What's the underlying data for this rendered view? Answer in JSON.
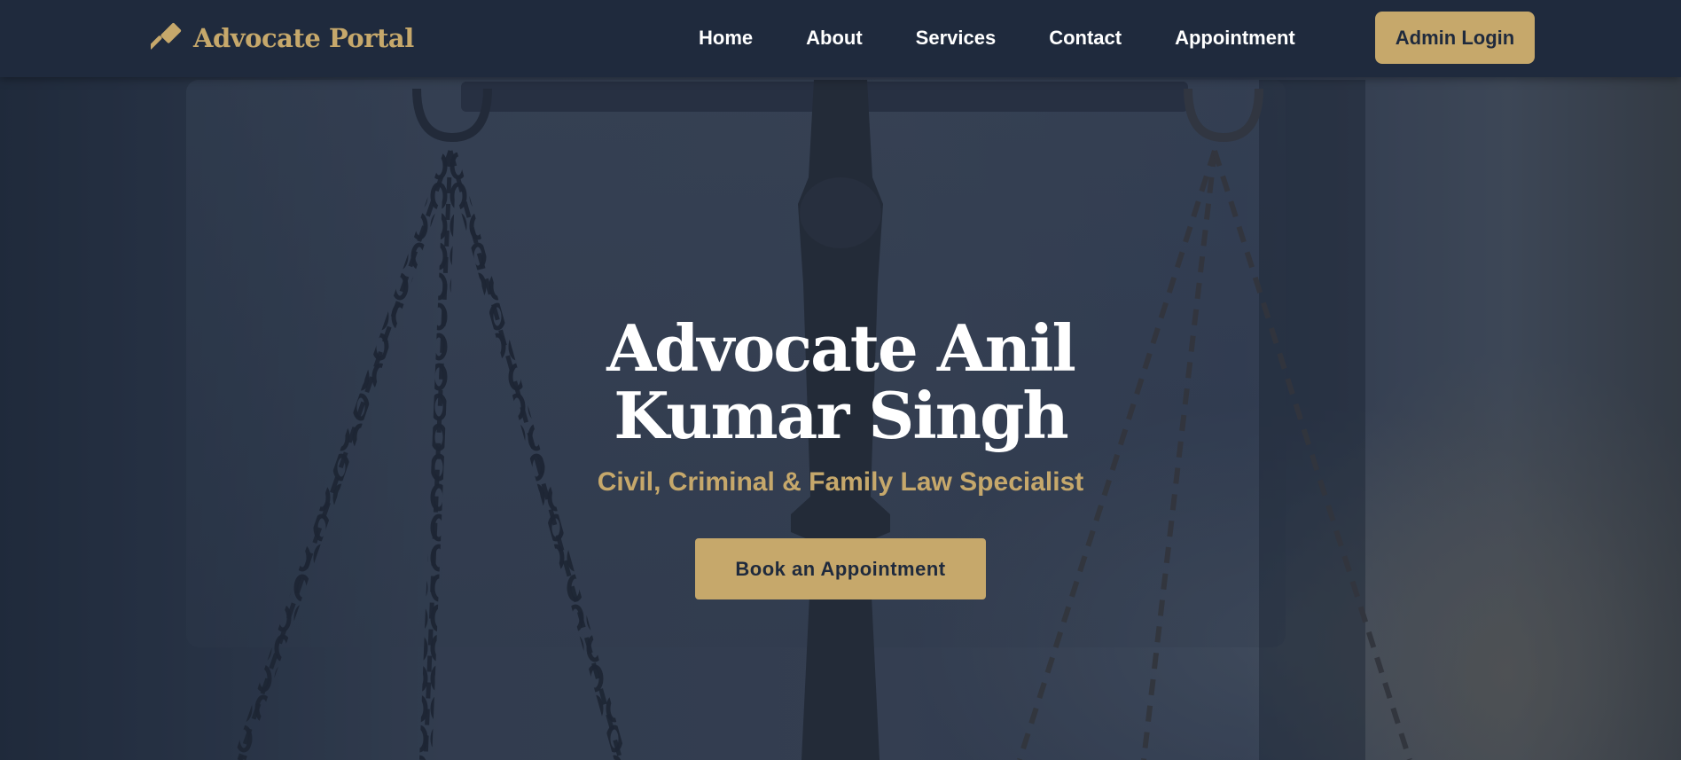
{
  "brand": {
    "name": "Advocate Portal",
    "icon": "gavel-icon"
  },
  "nav": {
    "links": [
      {
        "label": "Home"
      },
      {
        "label": "About"
      },
      {
        "label": "Services"
      },
      {
        "label": "Contact"
      },
      {
        "label": "Appointment"
      }
    ],
    "admin_login_label": "Admin Login"
  },
  "hero": {
    "title": "Advocate Anil Kumar Singh",
    "subtitle": "Civil, Criminal & Family Law Specialist",
    "cta_label": "Book an Appointment",
    "background_image": "scales-of-justice-image"
  },
  "colors": {
    "navy": "#1f2a3d",
    "gold": "#c6a86b",
    "white": "#ffffff"
  }
}
